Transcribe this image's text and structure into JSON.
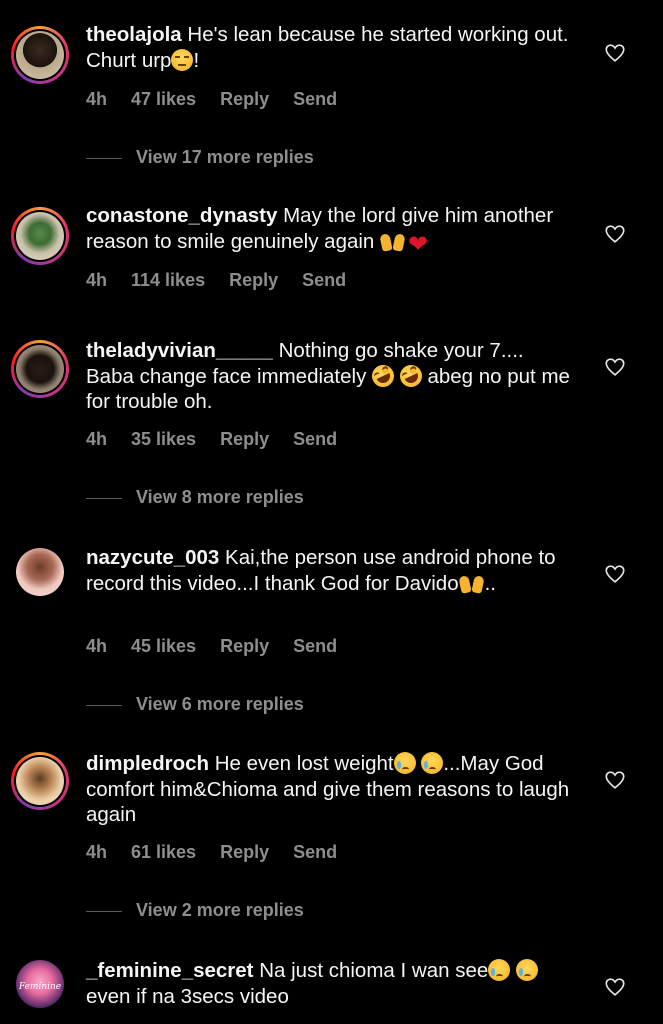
{
  "comments": [
    {
      "username": "theolajola",
      "text_parts": [
        "He's lean because he started working out. Churt urp",
        "!"
      ],
      "time": "4h",
      "likes": "47 likes",
      "reply": "Reply",
      "send": "Send",
      "view_replies": "View 17 more replies",
      "emoji": [
        "unamused-face-emoji"
      ]
    },
    {
      "username": "conastone_dynasty",
      "text_parts": [
        "May the lord give him another reason to smile genuinely again"
      ],
      "time": "4h",
      "likes": "114 likes",
      "reply": "Reply",
      "send": "Send",
      "emoji": [
        "raising-hands-emoji",
        "red-heart-emoji"
      ]
    },
    {
      "username": "theladyvivian_____",
      "text_parts": [
        "Nothing go shake your 7.... Baba change face immediately",
        "abeg no put me for trouble oh."
      ],
      "time": "4h",
      "likes": "35 likes",
      "reply": "Reply",
      "send": "Send",
      "view_replies": "View 8 more replies",
      "emoji": [
        "rolling-on-floor-laughing-emoji",
        "rolling-on-floor-laughing-emoji"
      ]
    },
    {
      "username": "nazycute_003",
      "text_parts": [
        "Kai,the person use android phone to record this video...I thank God for Davido",
        ".."
      ],
      "time": "4h",
      "likes": "45 likes",
      "reply": "Reply",
      "send": "Send",
      "view_replies": "View 6 more replies",
      "emoji": [
        "raising-hands-emoji"
      ]
    },
    {
      "username": "dimpledroch",
      "text_parts": [
        "He even lost weight",
        "...May God comfort him&Chioma and give them reasons to laugh again"
      ],
      "time": "4h",
      "likes": "61 likes",
      "reply": "Reply",
      "send": "Send",
      "view_replies": "View 2 more replies",
      "emoji": [
        "crying-face-emoji",
        "crying-face-emoji"
      ]
    },
    {
      "username": "_feminine_secret",
      "text_parts": [
        "Na just chioma I wan see",
        "even if na 3secs video"
      ],
      "avatar_text": "Feminine",
      "emoji": [
        "crying-face-emoji",
        "crying-face-emoji"
      ]
    }
  ],
  "colors": {
    "background": "#000000",
    "text": "#f5f5f5",
    "meta": "#8e8e8e",
    "story_ring": "#e1306c"
  }
}
